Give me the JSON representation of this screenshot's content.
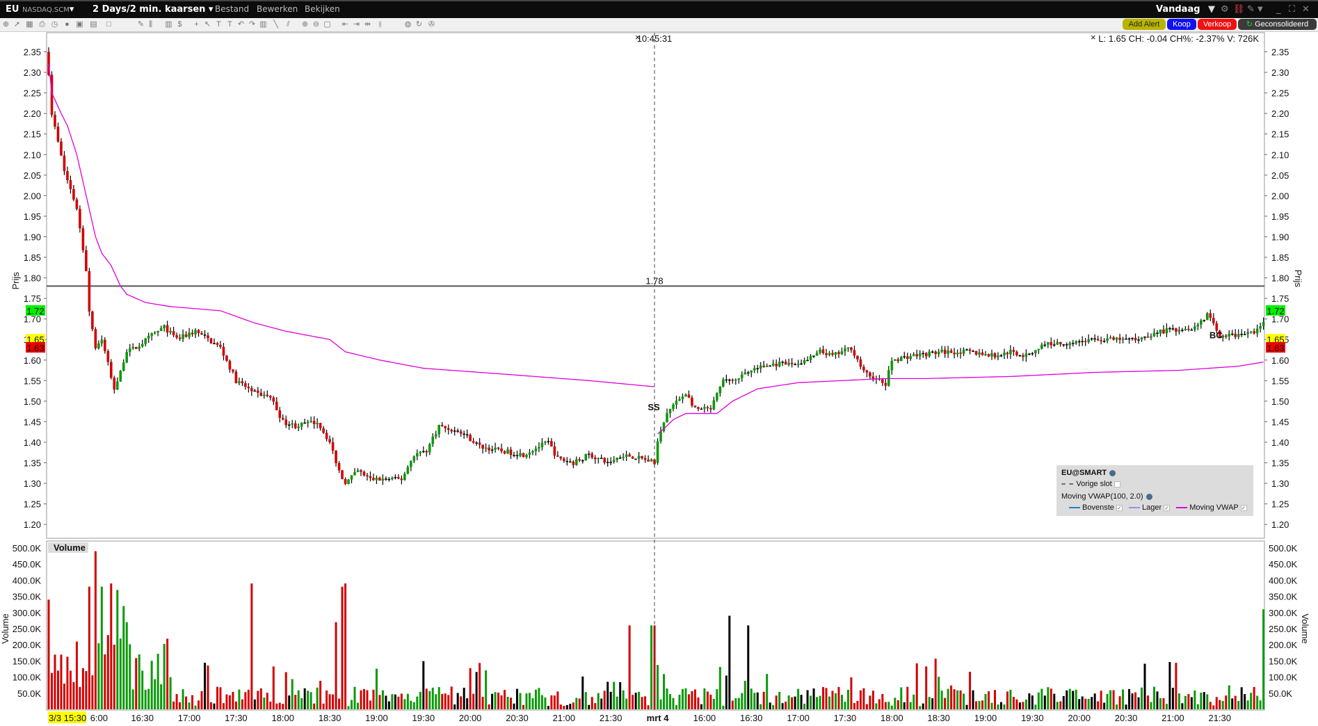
{
  "titlebar": {
    "symbol": "EU",
    "exchange": "NASDAQ.SCM",
    "period": "2 Days/2 min. kaarsen",
    "menus": [
      "Bestand",
      "Bewerken",
      "Bekijken"
    ],
    "range": "Vandaag"
  },
  "toolbar_icons": [
    "crosshair-icon",
    "pointer-icon",
    "grid-icon",
    "print-icon",
    "clock-icon",
    "circle-icon",
    "layout-icon",
    "chart-type-icon",
    "blank-icon",
    "pencil-icon",
    "bar-icon",
    "volume-icon",
    "dollar-icon",
    "cross-icon",
    "cursor-icon",
    "text-icon",
    "text-tag-icon",
    "undo-icon",
    "redo-icon",
    "study-icon",
    "line-icon",
    "fib-icon",
    "zoom-in-icon",
    "zoom-out-icon",
    "fit-icon",
    "pan-left-icon",
    "pan-right-icon",
    "pan-icon",
    "split-icon",
    "globe-icon",
    "refresh-icon",
    "wrench-icon"
  ],
  "buttons": {
    "add_alert": "Add Alert",
    "buy": "Koop",
    "sell": "Verkoop",
    "consolidated": "Geconsolideerd"
  },
  "colors": {
    "up": "#0a9a0a",
    "down": "#d40000",
    "vwap": "#dd00dd",
    "add_alert": "#b8b400",
    "buy": "#1010f0",
    "sell": "#f01010"
  },
  "chart": {
    "info": "L: 1.65 CH: -0.04 CH%: -2.37% V: 726K",
    "crosshair_time": "10:45:31",
    "hline_label": "1.78",
    "hline_value": 1.78,
    "price_axis_title": "Prijs",
    "volume_axis_title": "Volume",
    "price_ticks": [
      "2.35",
      "2.30",
      "2.25",
      "2.20",
      "2.15",
      "2.10",
      "2.05",
      "2.00",
      "1.95",
      "1.90",
      "1.85",
      "1.80",
      "1.75",
      "1.70",
      "1.65",
      "1.60",
      "1.55",
      "1.50",
      "1.45",
      "1.40",
      "1.35",
      "1.30",
      "1.25",
      "1.20"
    ],
    "price_tags": [
      {
        "text": "1.72",
        "value": 1.72,
        "color": "#00ee00"
      },
      {
        "text": "1.65",
        "value": 1.65,
        "color": "#ffff00"
      },
      {
        "text": "1.63",
        "value": 1.63,
        "color": "#ee0000"
      }
    ],
    "volume_ticks": [
      "500.0K",
      "450.0K",
      "400.0K",
      "350.0K",
      "300.0K",
      "250.0K",
      "200.0K",
      "150.0K",
      "100.0K",
      "50.0K"
    ],
    "volume_panel_label": "Volume",
    "markers": [
      {
        "text": "SS",
        "bar": 196,
        "price": 1.49
      },
      {
        "text": "BC",
        "bar": 376,
        "price": 1.665
      }
    ],
    "time_labels": [
      {
        "bar": 0,
        "text": "3/3 15:30",
        "highlight": true
      },
      {
        "bar": 15,
        "text": "16:00"
      },
      {
        "bar": 30,
        "text": "16:30"
      },
      {
        "bar": 45,
        "text": "17:00"
      },
      {
        "bar": 60,
        "text": "17:30"
      },
      {
        "bar": 75,
        "text": "18:00"
      },
      {
        "bar": 90,
        "text": "18:30"
      },
      {
        "bar": 105,
        "text": "19:00"
      },
      {
        "bar": 120,
        "text": "19:30"
      },
      {
        "bar": 135,
        "text": "20:00"
      },
      {
        "bar": 150,
        "text": "20:30"
      },
      {
        "bar": 165,
        "text": "21:00"
      },
      {
        "bar": 180,
        "text": "21:30"
      },
      {
        "bar": 195,
        "text": "mrt 4"
      },
      {
        "bar": 210,
        "text": "16:00"
      },
      {
        "bar": 225,
        "text": "16:30"
      },
      {
        "bar": 240,
        "text": "17:00"
      },
      {
        "bar": 255,
        "text": "17:30"
      },
      {
        "bar": 270,
        "text": "18:00"
      },
      {
        "bar": 285,
        "text": "18:30"
      },
      {
        "bar": 300,
        "text": "19:00"
      },
      {
        "bar": 315,
        "text": "19:30"
      },
      {
        "bar": 330,
        "text": "20:00"
      },
      {
        "bar": 345,
        "text": "20:30"
      },
      {
        "bar": 360,
        "text": "21:00"
      },
      {
        "bar": 375,
        "text": "21:30"
      }
    ]
  },
  "legend": {
    "title": "EU@SMART",
    "prev_close": "Vorige slot",
    "study": "Moving VWAP(100, 2.0)",
    "lines": [
      {
        "label": "Bovenste",
        "color": "#1f7fc8"
      },
      {
        "label": "Lager",
        "color": "#a08cf0"
      },
      {
        "label": "Moving VWAP",
        "color": "#dd00dd"
      }
    ]
  },
  "chart_data": {
    "type": "candlestick",
    "bars": 390,
    "bar_minutes": 2,
    "price_path": [
      [
        0,
        2.3
      ],
      [
        1,
        2.2
      ],
      [
        5,
        2.06
      ],
      [
        9,
        1.97
      ],
      [
        12,
        1.82
      ],
      [
        13,
        1.72
      ],
      [
        15,
        1.63
      ],
      [
        17,
        1.65
      ],
      [
        21,
        1.53
      ],
      [
        25,
        1.62
      ],
      [
        28,
        1.63
      ],
      [
        33,
        1.66
      ],
      [
        37,
        1.68
      ],
      [
        41,
        1.65
      ],
      [
        47,
        1.67
      ],
      [
        55,
        1.63
      ],
      [
        60,
        1.55
      ],
      [
        66,
        1.52
      ],
      [
        71,
        1.51
      ],
      [
        75,
        1.45
      ],
      [
        79,
        1.44
      ],
      [
        86,
        1.45
      ],
      [
        90,
        1.4
      ],
      [
        93,
        1.33
      ],
      [
        95,
        1.3
      ],
      [
        99,
        1.33
      ],
      [
        103,
        1.31
      ],
      [
        109,
        1.31
      ],
      [
        113,
        1.31
      ],
      [
        117,
        1.37
      ],
      [
        121,
        1.38
      ],
      [
        125,
        1.44
      ],
      [
        129,
        1.43
      ],
      [
        133,
        1.42
      ],
      [
        138,
        1.39
      ],
      [
        144,
        1.38
      ],
      [
        152,
        1.37
      ],
      [
        157,
        1.39
      ],
      [
        160,
        1.4
      ],
      [
        163,
        1.36
      ],
      [
        168,
        1.35
      ],
      [
        173,
        1.37
      ],
      [
        179,
        1.35
      ],
      [
        184,
        1.37
      ],
      [
        190,
        1.36
      ],
      [
        194,
        1.35
      ],
      [
        195,
        1.4
      ],
      [
        198,
        1.47
      ],
      [
        200,
        1.49
      ],
      [
        204,
        1.52
      ],
      [
        207,
        1.48
      ],
      [
        212,
        1.48
      ],
      [
        216,
        1.55
      ],
      [
        222,
        1.56
      ],
      [
        226,
        1.58
      ],
      [
        233,
        1.59
      ],
      [
        239,
        1.59
      ],
      [
        243,
        1.6
      ],
      [
        247,
        1.62
      ],
      [
        251,
        1.61
      ],
      [
        257,
        1.63
      ],
      [
        261,
        1.57
      ],
      [
        268,
        1.54
      ],
      [
        270,
        1.6
      ],
      [
        276,
        1.61
      ],
      [
        286,
        1.62
      ],
      [
        295,
        1.62
      ],
      [
        303,
        1.61
      ],
      [
        308,
        1.62
      ],
      [
        313,
        1.61
      ],
      [
        319,
        1.64
      ],
      [
        324,
        1.64
      ],
      [
        335,
        1.65
      ],
      [
        348,
        1.65
      ],
      [
        356,
        1.67
      ],
      [
        367,
        1.68
      ],
      [
        371,
        1.71
      ],
      [
        375,
        1.66
      ],
      [
        381,
        1.66
      ],
      [
        386,
        1.67
      ],
      [
        389,
        1.69
      ]
    ],
    "vwap_path": [
      [
        0,
        2.32
      ],
      [
        1,
        2.25
      ],
      [
        4,
        2.2
      ],
      [
        6,
        2.17
      ],
      [
        9,
        2.1
      ],
      [
        12,
        2.0
      ],
      [
        15,
        1.9
      ],
      [
        17,
        1.86
      ],
      [
        20,
        1.83
      ],
      [
        23,
        1.78
      ],
      [
        25,
        1.76
      ],
      [
        31,
        1.74
      ],
      [
        39,
        1.73
      ],
      [
        55,
        1.72
      ],
      [
        66,
        1.69
      ],
      [
        76,
        1.67
      ],
      [
        90,
        1.65
      ],
      [
        95,
        1.62
      ],
      [
        106,
        1.6
      ],
      [
        120,
        1.58
      ],
      [
        147,
        1.565
      ],
      [
        173,
        1.55
      ],
      [
        194,
        1.535
      ],
      [
        195,
        1.42
      ],
      [
        198,
        1.44
      ],
      [
        200,
        1.455
      ],
      [
        204,
        1.47
      ],
      [
        214,
        1.47
      ],
      [
        219,
        1.5
      ],
      [
        227,
        1.53
      ],
      [
        240,
        1.545
      ],
      [
        254,
        1.55
      ],
      [
        268,
        1.555
      ],
      [
        281,
        1.555
      ],
      [
        308,
        1.56
      ],
      [
        335,
        1.57
      ],
      [
        362,
        1.575
      ],
      [
        381,
        1.585
      ],
      [
        389,
        1.595
      ]
    ],
    "volume_spikes": [
      [
        0,
        340
      ],
      [
        13,
        380
      ],
      [
        15,
        490
      ],
      [
        17,
        380
      ],
      [
        19,
        230
      ],
      [
        20,
        390
      ],
      [
        22,
        370
      ],
      [
        24,
        320
      ],
      [
        25,
        270
      ],
      [
        65,
        390
      ],
      [
        92,
        270
      ],
      [
        94,
        380
      ],
      [
        95,
        390
      ],
      [
        186,
        260
      ],
      [
        193,
        260
      ],
      [
        194,
        260
      ],
      [
        218,
        290
      ],
      [
        224,
        260
      ],
      [
        389,
        310
      ]
    ],
    "price_range": [
      1.175,
      2.39
    ],
    "volume_range": [
      0,
      530
    ]
  }
}
